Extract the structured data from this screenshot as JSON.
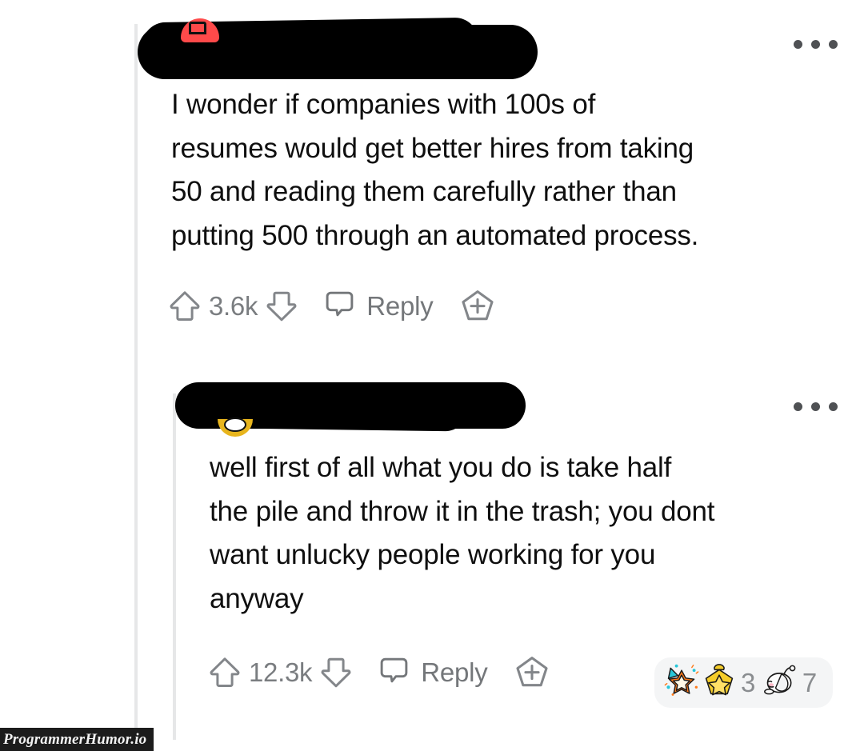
{
  "meta": {
    "platform": "reddit-comment-thread",
    "watermark": "ProgrammerHumor.io",
    "colors": {
      "background": "#ffffff",
      "text": "#0f0f0f",
      "muted": "#7a7d80",
      "thread_line": "#e6e7e8",
      "pill_background": "#f4f5f6",
      "redaction": "#000000",
      "avatar_red": "#ff4a4a",
      "avatar_gold": "#e8b51d"
    }
  },
  "comments": [
    {
      "id": "comment-1",
      "depth": 0,
      "author_redacted": true,
      "author_label": "",
      "overflow_label": "more options",
      "body": "I wonder if companies with 100s of\nresumes would get better hires from taking\n50 and reading them carefully rather than\nputting 500 through an automated process.",
      "actions": {
        "upvote_icon": "upvote-arrow-icon",
        "score": "3.6k",
        "downvote_icon": "downvote-arrow-icon",
        "reply_icon": "comment-bubble-icon",
        "reply_label": "Reply",
        "award_icon": "award-plus-pentagon-icon"
      },
      "awards": []
    },
    {
      "id": "comment-2",
      "depth": 1,
      "author_redacted": true,
      "author_label": "",
      "overflow_label": "more options",
      "body": "well first of all what you do is take half\nthe pile and throw it in the trash; you dont\nwant unlucky people working for you\nanyway",
      "actions": {
        "upvote_icon": "upvote-arrow-icon",
        "score": "12.3k",
        "downvote_icon": "downvote-arrow-icon",
        "reply_icon": "comment-bubble-icon",
        "reply_label": "Reply",
        "award_icon": "award-plus-pentagon-icon"
      },
      "awards": [
        {
          "icon": "starstruck-award-icon",
          "count": ""
        },
        {
          "icon": "gold-star-medal-award-icon",
          "count": "3"
        },
        {
          "icon": "snoo-white-award-icon",
          "count": "7"
        }
      ]
    }
  ]
}
